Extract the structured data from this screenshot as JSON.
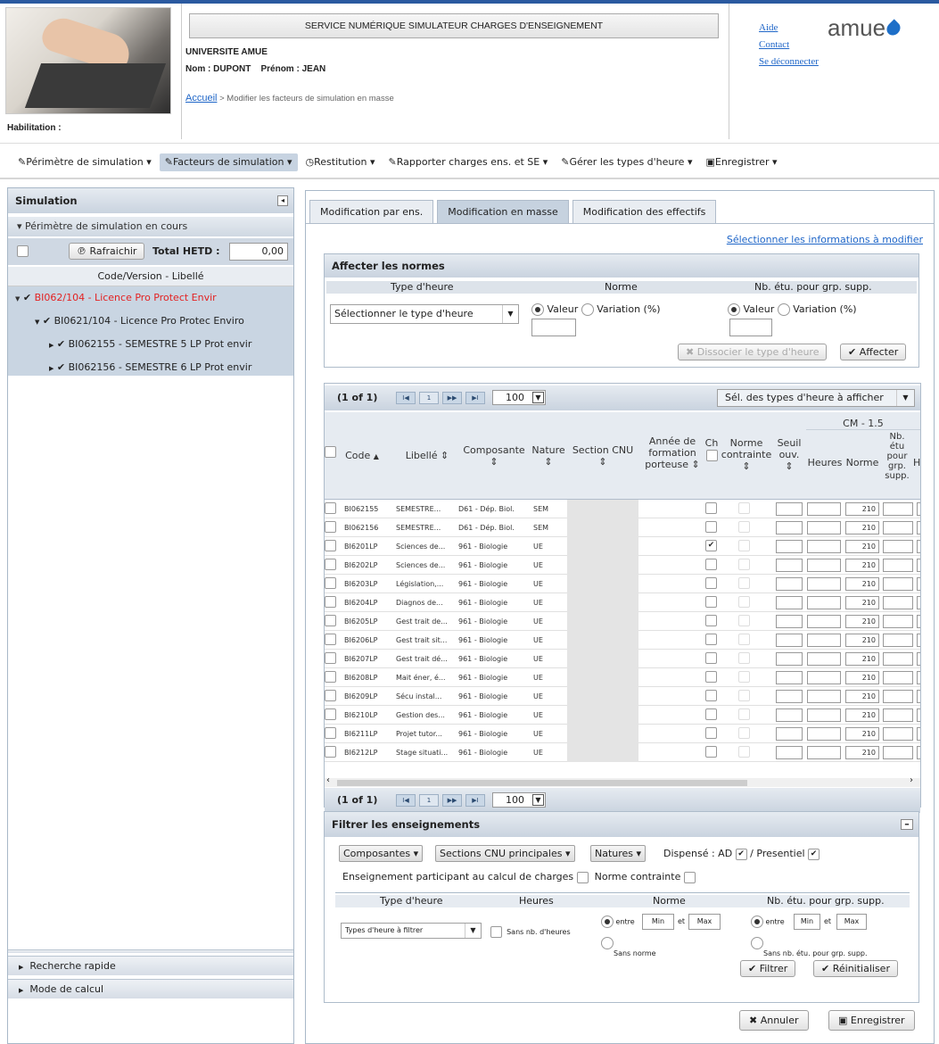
{
  "header": {
    "service_title": "SERVICE NUMÉRIQUE SIMULATEUR CHARGES D'ENSEIGNEMENT",
    "university": "UNIVERSITE AMUE",
    "nom": "Nom : DUPONT",
    "prenom": "Prénom : JEAN",
    "habilitation": "Habilitation :",
    "breadcrumb_home": "Accueil",
    "breadcrumb_rest": " > Modifier les facteurs de simulation en masse",
    "links": {
      "aide": "Aide",
      "contact": "Contact",
      "logout": "Se déconnecter"
    },
    "logo": "amue"
  },
  "menu": [
    {
      "label": "Périmètre de simulation ▾",
      "icon": "pencil-icon"
    },
    {
      "label": "Facteurs de simulation ▾",
      "icon": "pencil-icon",
      "active": true
    },
    {
      "label": "Restitution ▾",
      "icon": "clock-icon"
    },
    {
      "label": "Rapporter charges ens. et SE ▾",
      "icon": "pencil-icon"
    },
    {
      "label": "Gérer les types d'heure ▾",
      "icon": "pencil-icon"
    },
    {
      "label": "Enregistrer ▾",
      "icon": "save-icon"
    }
  ],
  "left": {
    "title": "Simulation",
    "perimetre": "▾ Périmètre de simulation en cours",
    "refresh": "Rafraichir",
    "total_label": "Total HETD :",
    "total_value": "0,00",
    "col_header": "Code/Version - Libellé",
    "tree": [
      {
        "label": "BI062/104 - Licence Pro Protect Envir",
        "level": 0,
        "red": true
      },
      {
        "label": "BI0621/104 - Licence Pro Protec Enviro",
        "level": 1
      },
      {
        "label": "BI062155 - SEMESTRE 5 LP Prot envir",
        "level": 2
      },
      {
        "label": "BI062156 - SEMESTRE 6 LP Prot envir",
        "level": 2
      }
    ],
    "recherche": "Recherche rapide",
    "mode": "Mode de calcul"
  },
  "tabs": [
    "Modification par ens.",
    "Modification en masse",
    "Modification des effectifs"
  ],
  "select_link": "Sélectionner les informations à modifier",
  "norms": {
    "title": "Affecter les normes",
    "col_type": "Type d'heure",
    "col_norme": "Norme",
    "col_nb": "Nb. étu. pour grp. supp.",
    "select_placeholder": "Sélectionner le type d'heure",
    "valeur": "Valeur",
    "variation": "Variation (%)",
    "dissocier": "Dissocier le type d'heure",
    "affecter": "Affecter"
  },
  "grid": {
    "pager_text": "(1 of 1)",
    "page_num": "1",
    "page_size": "100",
    "types_select": "Sél. des types d'heure à afficher",
    "headers": {
      "code": "Code",
      "libelle": "Libellé",
      "composante": "Composante",
      "nature": "Nature",
      "section": "Section CNU",
      "annee": "Année de formation porteuse",
      "ch": "Ch",
      "norme_contrainte": "Norme contrainte",
      "seuil": "Seuil ouv.",
      "cm": "CM - 1.5",
      "heures": "Heures",
      "norme": "Norme",
      "nbetu": "Nb. étu pour grp. supp.",
      "h": "H"
    },
    "rows": [
      {
        "code": "BI062155",
        "libelle": "SEMESTRE...",
        "comp": "D61 - Dép. Biol.",
        "nature": "SEM",
        "checked": false,
        "norme": "210"
      },
      {
        "code": "BI062156",
        "libelle": "SEMESTRE...",
        "comp": "D61 - Dép. Biol.",
        "nature": "SEM",
        "checked": false,
        "norme": "210"
      },
      {
        "code": "BI6201LP",
        "libelle": "Sciences de...",
        "comp": "961 - Biologie",
        "nature": "UE",
        "checked": true,
        "norme": "210"
      },
      {
        "code": "BI6202LP",
        "libelle": "Sciences de...",
        "comp": "961 - Biologie",
        "nature": "UE",
        "checked": false,
        "norme": "210"
      },
      {
        "code": "BI6203LP",
        "libelle": "Législation,...",
        "comp": "961 - Biologie",
        "nature": "UE",
        "checked": false,
        "norme": "210"
      },
      {
        "code": "BI6204LP",
        "libelle": "Diagnos de...",
        "comp": "961 - Biologie",
        "nature": "UE",
        "checked": false,
        "norme": "210"
      },
      {
        "code": "BI6205LP",
        "libelle": "Gest trait de...",
        "comp": "961 - Biologie",
        "nature": "UE",
        "checked": false,
        "norme": "210"
      },
      {
        "code": "BI6206LP",
        "libelle": "Gest trait sit...",
        "comp": "961 - Biologie",
        "nature": "UE",
        "checked": false,
        "norme": "210"
      },
      {
        "code": "BI6207LP",
        "libelle": "Gest trait dé...",
        "comp": "961 - Biologie",
        "nature": "UE",
        "checked": false,
        "norme": "210"
      },
      {
        "code": "BI6208LP",
        "libelle": "Mait éner, é...",
        "comp": "961 - Biologie",
        "nature": "UE",
        "checked": false,
        "norme": "210"
      },
      {
        "code": "BI6209LP",
        "libelle": "Sécu instal...",
        "comp": "961 - Biologie",
        "nature": "UE",
        "checked": false,
        "norme": "210"
      },
      {
        "code": "BI6210LP",
        "libelle": "Gestion des...",
        "comp": "961 - Biologie",
        "nature": "UE",
        "checked": false,
        "norme": "210"
      },
      {
        "code": "BI6211LP",
        "libelle": "Projet tutor...",
        "comp": "961 - Biologie",
        "nature": "UE",
        "checked": false,
        "norme": "210"
      },
      {
        "code": "BI6212LP",
        "libelle": "Stage situati...",
        "comp": "961 - Biologie",
        "nature": "UE",
        "checked": false,
        "norme": "210"
      }
    ]
  },
  "filter": {
    "title": "Filtrer les enseignements",
    "composantes": "Composantes ▾",
    "sections": "Sections CNU principales ▾",
    "natures": "Natures ▾",
    "dispense": "Dispensé : AD",
    "presentiel": "/ Presentiel",
    "participant": "Enseignement participant au calcul de charges",
    "norme_contrainte": "Norme contrainte",
    "col_type": "Type d'heure",
    "col_heures": "Heures",
    "col_norme": "Norme",
    "col_nb": "Nb. étu. pour grp. supp.",
    "types_select": "Types d'heure à filtrer",
    "sans_heures": "Sans nb. d'heures",
    "entre": "entre",
    "et": "et",
    "min": "Min",
    "max": "Max",
    "sans_norme": "Sans norme",
    "sans_nb": "Sans nb. étu. pour grp. supp.",
    "filtrer": "Filtrer",
    "reinit": "Réinitialiser"
  },
  "footer": {
    "annuler": "Annuler",
    "enregistrer": "Enregistrer"
  }
}
